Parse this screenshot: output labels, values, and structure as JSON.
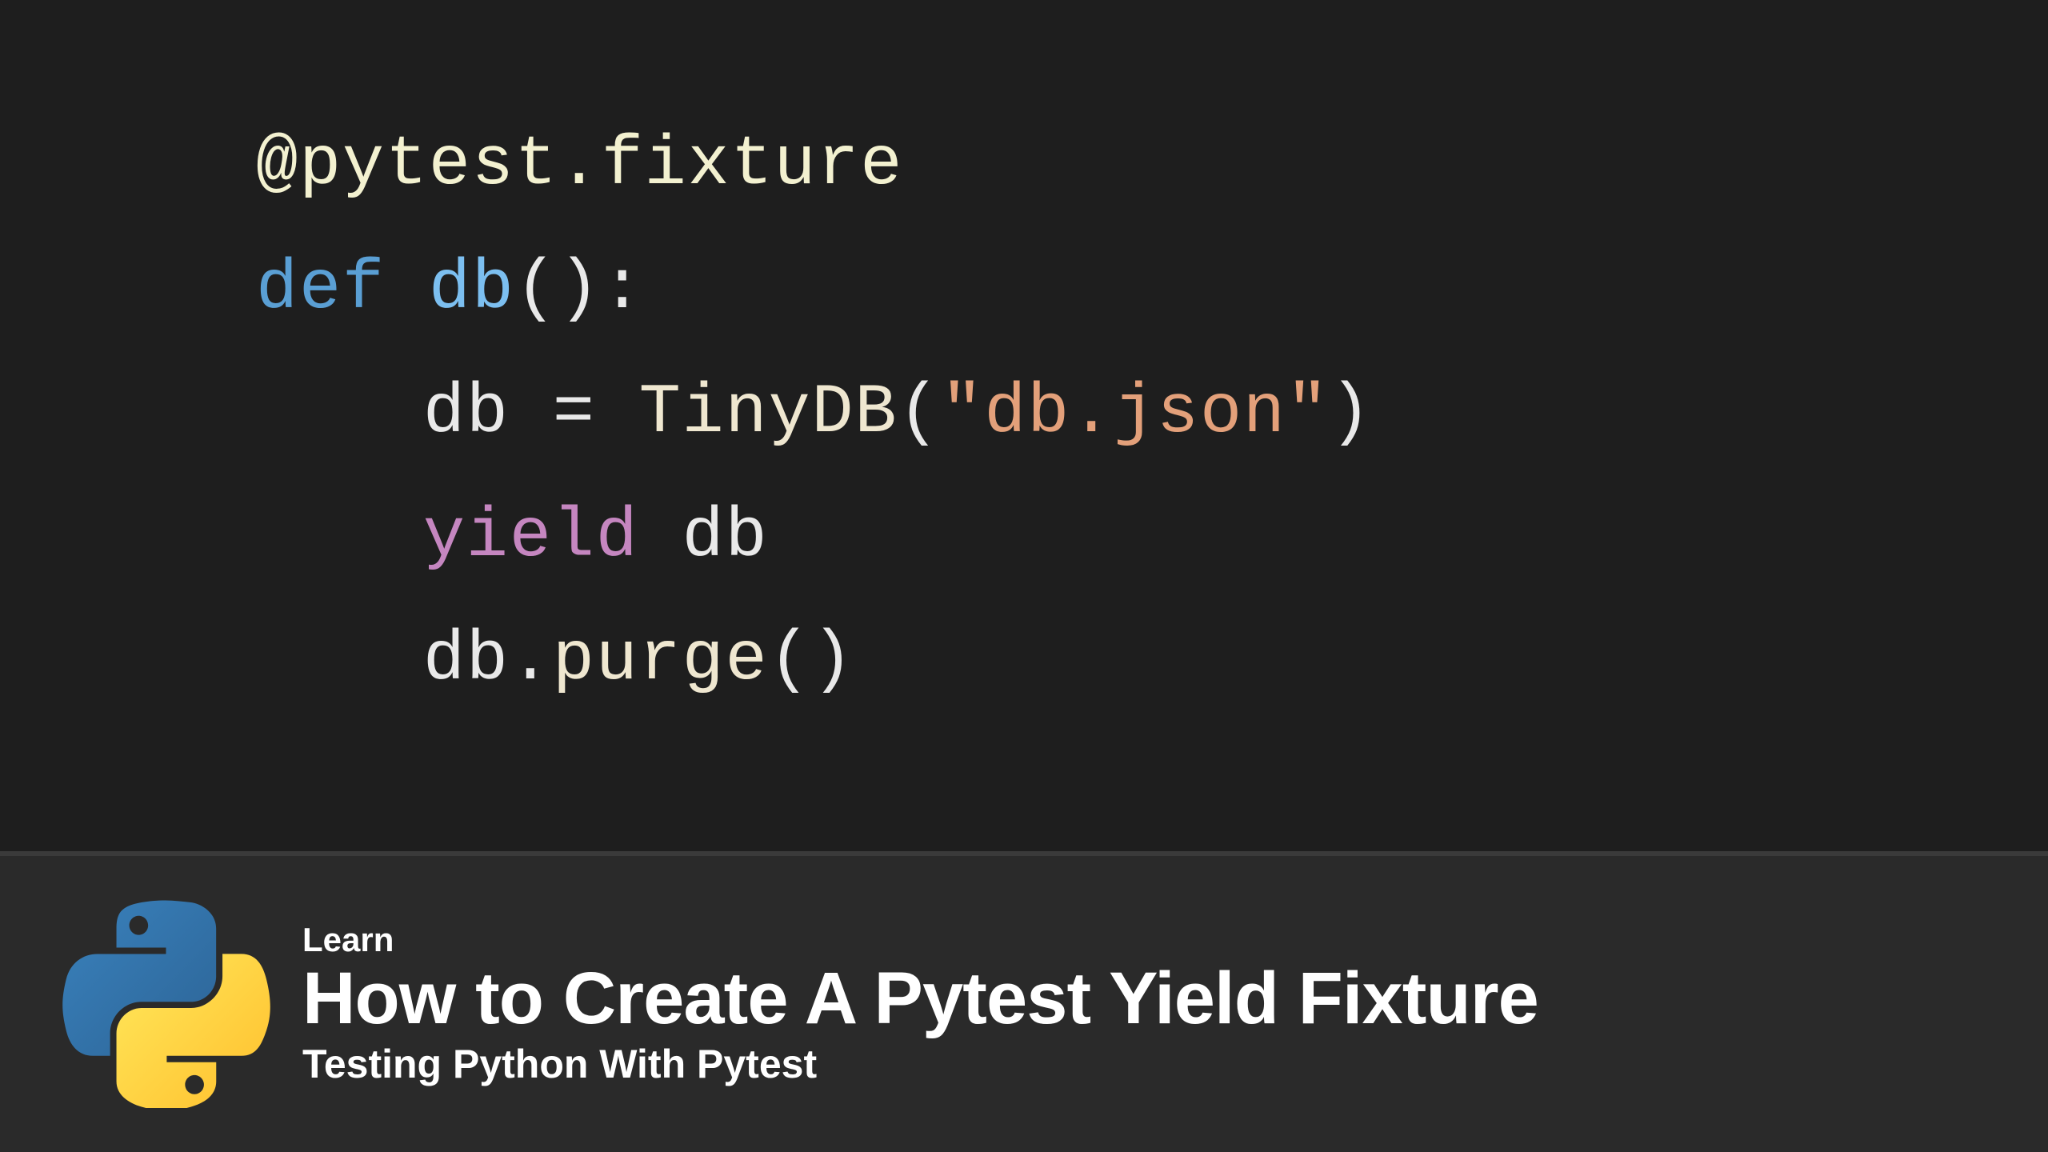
{
  "code": {
    "decorator_at": "@",
    "decorator_module": "pytest",
    "decorator_dot": ".",
    "decorator_attr": "fixture",
    "def_kw": "def",
    "func_name": "db",
    "paren_open": "(",
    "paren_close": ")",
    "colon": ":",
    "assign_lhs": "db",
    "equals": "=",
    "tiny_class": "TinyDB",
    "string_arg": "\"db.json\"",
    "yield_kw": "yield",
    "yield_var": "db",
    "purge_obj": "db",
    "purge_dot": ".",
    "purge_method": "purge",
    "call_open": "(",
    "call_close": ")"
  },
  "footer": {
    "eyebrow": "Learn",
    "title": "How to Create A Pytest Yield Fixture",
    "subtitle": "Testing Python With Pytest"
  }
}
